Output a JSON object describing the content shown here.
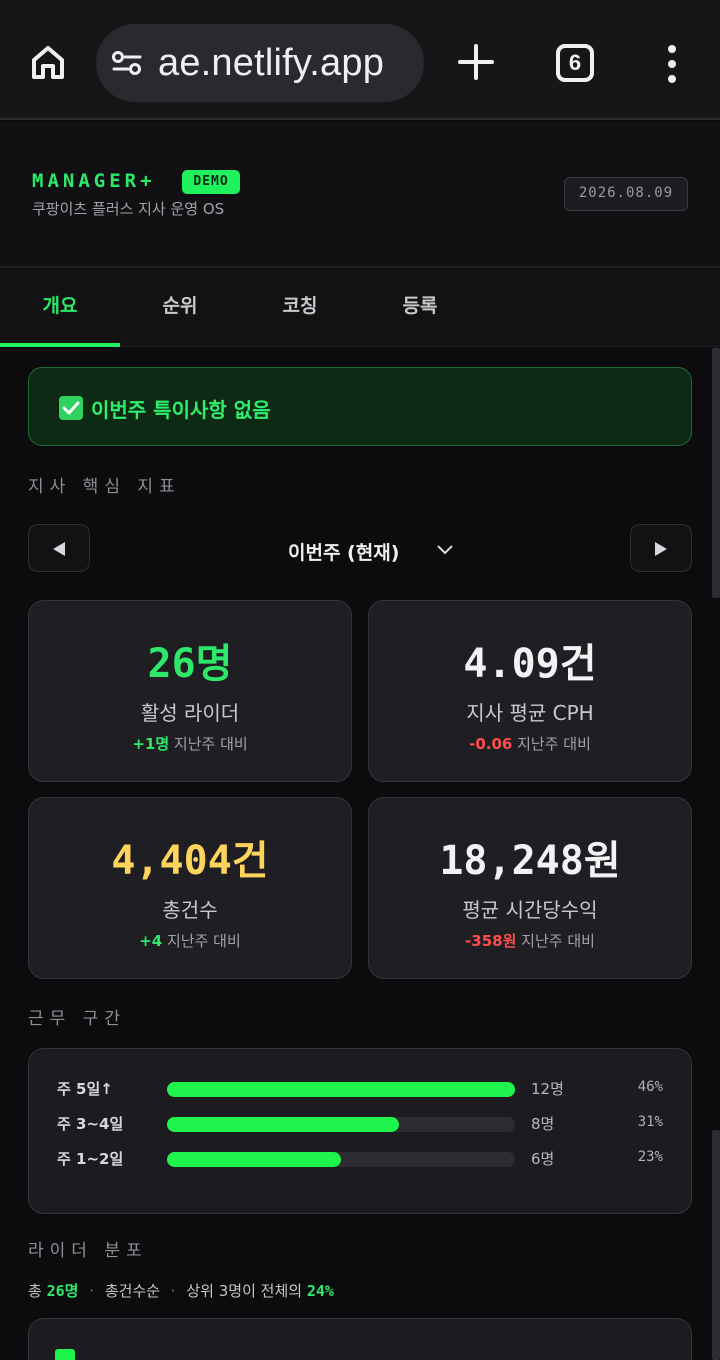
{
  "browser": {
    "url": "ae.netlify.app",
    "tab_count": "6"
  },
  "header": {
    "brand": "MANAGER+",
    "badge": "DEMO",
    "subtitle": "쿠팡이츠 플러스 지사 운영 OS",
    "date": "2026.08.09"
  },
  "tabs": [
    {
      "label": "개요",
      "active": true
    },
    {
      "label": "순위",
      "active": false
    },
    {
      "label": "코칭",
      "active": false
    },
    {
      "label": "등록",
      "active": false
    }
  ],
  "alert": {
    "text": "이번주 특이사항 없음"
  },
  "kpi_section": {
    "label": "지사 핵심 지표",
    "week": "이번주 (현재)"
  },
  "kpis": [
    {
      "value": "26명",
      "label": "활성 라이더",
      "delta": "+1명",
      "delta_suffix": "지난주 대비",
      "value_color": "#2ee86a",
      "delta_color": "#2ee86a"
    },
    {
      "value": "4.09건",
      "label": "지사 평균 CPH",
      "delta": "-0.06",
      "delta_suffix": "지난주 대비",
      "value_color": "#f2f2f4",
      "delta_color": "#ff4d4d"
    },
    {
      "value": "4,404건",
      "label": "총건수",
      "delta": "+4",
      "delta_suffix": "지난주 대비",
      "value_color": "#ffd45a",
      "delta_color": "#2ee86a"
    },
    {
      "value": "18,248원",
      "label": "평균 시간당수익",
      "delta": "-358원",
      "delta_suffix": "지난주 대비",
      "value_color": "#f2f2f4",
      "delta_color": "#ff4d4d"
    }
  ],
  "work_bands": {
    "label": "근무 구간",
    "rows": [
      {
        "label": "주 5일↑",
        "count": "12명",
        "pct": "46%",
        "fraction": 1.0
      },
      {
        "label": "주 3~4일",
        "count": "8명",
        "pct": "31%",
        "fraction": 0.667
      },
      {
        "label": "주 1~2일",
        "count": "6명",
        "pct": "23%",
        "fraction": 0.5
      }
    ]
  },
  "distribution": {
    "label": "라이더 분포",
    "prefix": "총",
    "total": "26명",
    "sort": "총건수순",
    "top_text": "상위 3명이 전체의",
    "top_pct": "24%"
  },
  "icons": {
    "home": "home-icon",
    "site_settings": "tune-icon",
    "new_tab": "plus-icon",
    "tab_switcher": "tabs-icon",
    "menu": "kebab-icon",
    "alert": "check-box-icon",
    "prev": "triangle-left-icon",
    "next": "triangle-right-icon",
    "dropdown": "chevron-down-icon"
  },
  "colors": {
    "accent": "#1ef25c",
    "background": "#0c0c0e",
    "card": "#1f1f23",
    "negative": "#ff4d4d",
    "warning": "#ffd45a"
  }
}
